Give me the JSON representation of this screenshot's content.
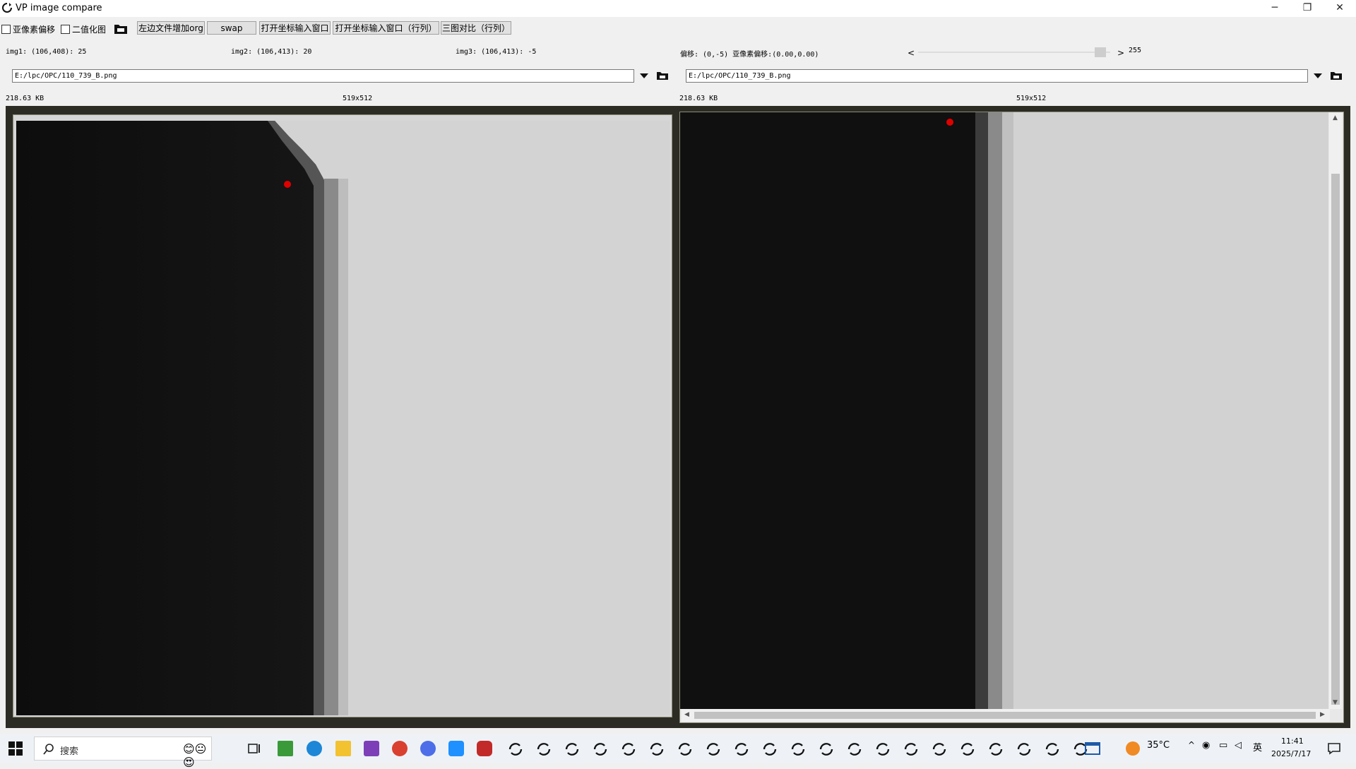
{
  "window": {
    "title": "VP image compare",
    "min_glyph": "─",
    "max_glyph": "❐",
    "close_glyph": "✕"
  },
  "toolbar": {
    "subpixel_label": "亚像素偏移",
    "binary_label": "二值化图",
    "add_org_label": "左边文件增加org",
    "swap_label": "swap",
    "open_coord_label": "打开坐标输入窗口",
    "open_coord_rowcol_label": "打开坐标输入窗口（行列）",
    "three_compare_label": "三图对比（行列）"
  },
  "info": {
    "img1": "img1: (106,408): 25",
    "img2": "img2: (106,413): 20",
    "img3": "img3: (106,413): -5",
    "offset": "偏移: (0,-5) 亚像素偏移:(0.00,0.00)",
    "slider_lt": "<",
    "slider_gt": ">",
    "threshold": "255",
    "threshold_level": 0.95
  },
  "left": {
    "path": "E:/lpc/OPC/110_739_B.png",
    "size": "218.63 KB",
    "dims": "519x512"
  },
  "right": {
    "path": "E:/lpc/OPC/110_739_B.png",
    "size": "218.63 KB",
    "dims": "519x512"
  },
  "taskbar": {
    "search_label": "搜索",
    "temperature": "35°C",
    "ime": "英",
    "time": "11:41",
    "date": "2025/7/17"
  },
  "colors": {
    "marker": "#e00000",
    "frame": "#2c2c24"
  }
}
